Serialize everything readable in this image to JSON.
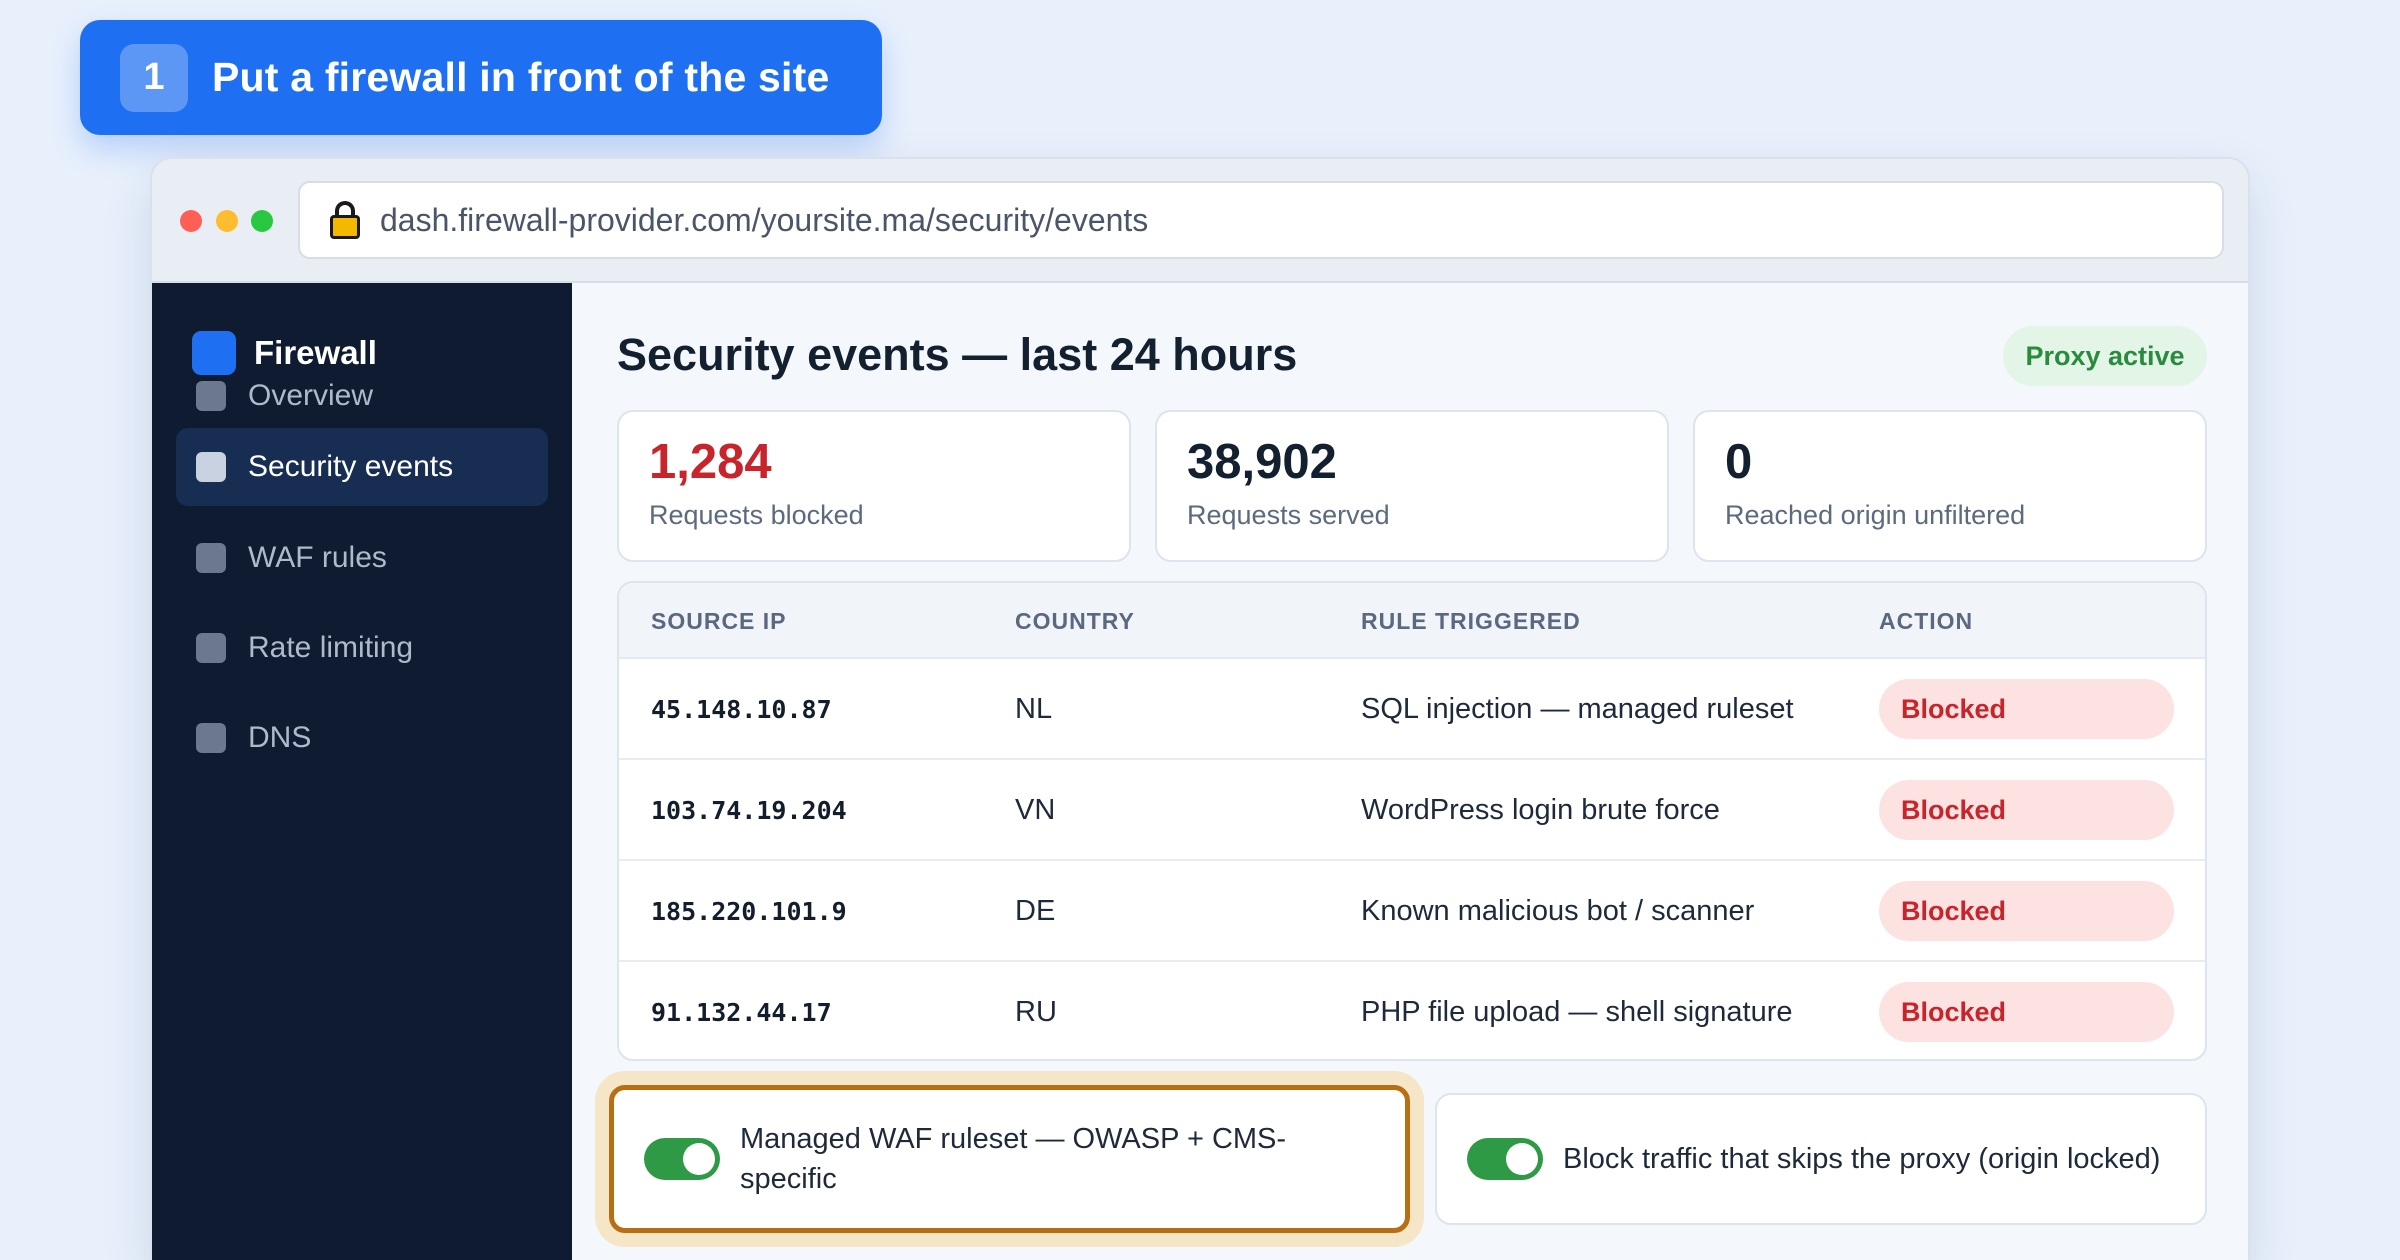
{
  "step": {
    "number": "1",
    "title": "Put a firewall in front of the site"
  },
  "browser": {
    "url": "dash.firewall-provider.com/yoursite.ma/security/events"
  },
  "sidebar": {
    "brand": "Firewall",
    "items": [
      {
        "label": "Overview",
        "active": false
      },
      {
        "label": "Security events",
        "active": true
      },
      {
        "label": "WAF rules",
        "active": false
      },
      {
        "label": "Rate limiting",
        "active": false
      },
      {
        "label": "DNS",
        "active": false
      }
    ]
  },
  "main": {
    "title": "Security events — last 24 hours",
    "badge": "Proxy active",
    "stats": [
      {
        "value": "1,284",
        "label": "Requests blocked"
      },
      {
        "value": "38,902",
        "label": "Requests served"
      },
      {
        "value": "0",
        "label": "Reached origin unfiltered"
      }
    ],
    "table": {
      "headers": [
        "SOURCE IP",
        "COUNTRY",
        "RULE TRIGGERED",
        "ACTION"
      ],
      "rows": [
        {
          "ip": "45.148.10.87",
          "country": "NL",
          "rule": "SQL injection — managed ruleset",
          "action": "Blocked"
        },
        {
          "ip": "103.74.19.204",
          "country": "VN",
          "rule": "WordPress login brute force",
          "action": "Blocked"
        },
        {
          "ip": "185.220.101.9",
          "country": "DE",
          "rule": "Known malicious bot / scanner",
          "action": "Blocked"
        },
        {
          "ip": "91.132.44.17",
          "country": "RU",
          "rule": "PHP file upload — shell signature",
          "action": "Blocked"
        }
      ]
    },
    "toggles": [
      {
        "label": "Managed WAF ruleset — OWASP + CMS-specific",
        "enabled": true
      },
      {
        "label": "Block traffic that skips the proxy (origin locked)",
        "enabled": true
      }
    ]
  },
  "colors": {
    "accent": "#1f6ff2",
    "sidebar_bg": "#0f1b30",
    "danger": "#c8242b",
    "success": "#2e9a45",
    "highlight": "#b86e12"
  }
}
